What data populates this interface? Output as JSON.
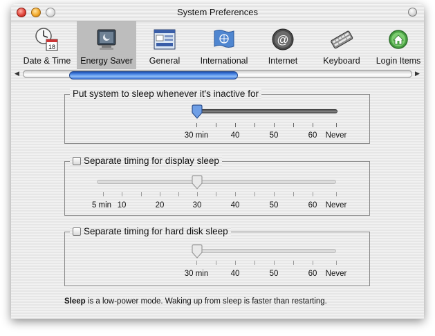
{
  "window": {
    "title": "System Preferences"
  },
  "toolbar": {
    "items": [
      {
        "label": "Date & Time",
        "icon": "clock-calendar-icon",
        "calendar_day": "18"
      },
      {
        "label": "Energy Saver",
        "icon": "energy-saver-icon",
        "selected": true
      },
      {
        "label": "General",
        "icon": "general-window-icon"
      },
      {
        "label": "International",
        "icon": "un-flag-icon"
      },
      {
        "label": "Internet",
        "icon": "at-sign-globe-icon",
        "symbol": "@"
      },
      {
        "label": "Keyboard",
        "icon": "keyboard-icon"
      },
      {
        "label": "Login Items",
        "icon": "house-icon"
      }
    ]
  },
  "sleep_group": {
    "legend": "Put system to sleep whenever it's inactive for",
    "ticks": [
      "30 min",
      "40",
      "50",
      "60",
      "Never"
    ],
    "value": "30 min"
  },
  "display_group": {
    "checkbox_label": "Separate timing for display sleep",
    "checked": false,
    "ticks": [
      "5 min",
      "10",
      "20",
      "30",
      "40",
      "50",
      "60",
      "Never"
    ],
    "value": "30"
  },
  "disk_group": {
    "checkbox_label": "Separate timing for hard disk sleep",
    "checked": false,
    "ticks": [
      "30 min",
      "40",
      "50",
      "60",
      "Never"
    ],
    "value": "30 min"
  },
  "footer": {
    "bold": "Sleep",
    "text": " is a low-power mode.  Waking up from sleep is faster than restarting."
  },
  "colors": {
    "accent": "#3d74d6",
    "selected_tab": "#bdbdbd"
  }
}
